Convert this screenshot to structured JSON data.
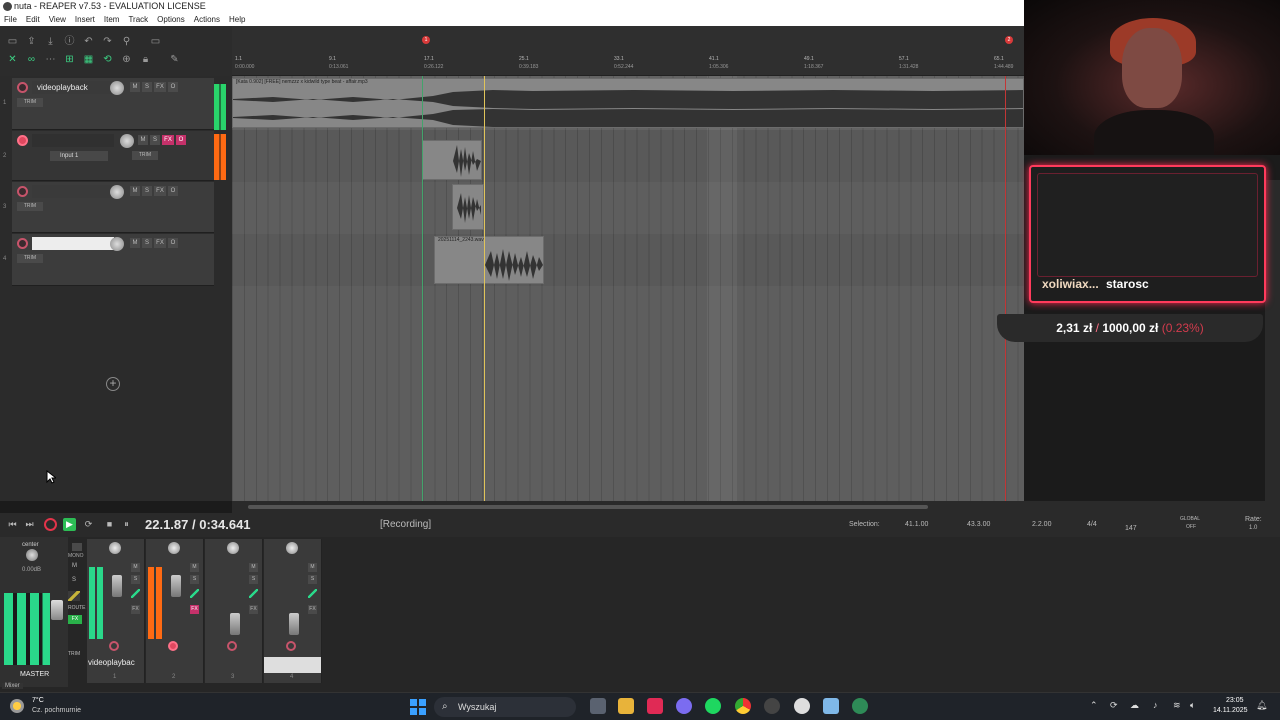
{
  "window": {
    "title": "nuta - REAPER v7.53 - EVALUATION LICENSE"
  },
  "menu": [
    "File",
    "Edit",
    "View",
    "Insert",
    "Item",
    "Track",
    "Options",
    "Actions",
    "Help"
  ],
  "tracks": [
    {
      "number": "1",
      "name": "videoplayback",
      "trim": "TRIM",
      "armed": false
    },
    {
      "number": "2",
      "name": "",
      "trim": "TRIM",
      "input": "Input 1",
      "armed": true
    },
    {
      "number": "3",
      "name": "",
      "trim": "TRIM",
      "armed": false
    },
    {
      "number": "4",
      "name": "",
      "trim": "TRIM",
      "armed": false
    }
  ],
  "track_buttons": {
    "mute": "M",
    "solo": "S",
    "fx": "FX",
    "route": "O"
  },
  "ruler": {
    "measures": [
      "1.1",
      "9.1",
      "17.1",
      "25.1",
      "33.1",
      "41.1",
      "49.1",
      "57.1",
      "65.1"
    ],
    "times": [
      "0:00.000",
      "0:13.061",
      "0:26.122",
      "0:39.183",
      "0:52.244",
      "1:05.306",
      "1:18.367",
      "1:31.428",
      "1:44.489"
    ],
    "markers": [
      "1",
      "2"
    ]
  },
  "items": {
    "track1": "[Kata 0.902] [FREE] nemzzz x kidwild type beat - affair.mp3",
    "track4": "20251114_2243.wav"
  },
  "transport": {
    "time": "22.1.87 / 0:34.641",
    "status": "[Recording]",
    "selection_label": "Selection:",
    "sel_start": "41.1.00",
    "sel_end": "43.3.00",
    "sel_len": "2.2.00",
    "time_sig": "4/4",
    "bpm": "147",
    "global": "GLOBAL",
    "global_off": "OFF",
    "rate_label": "Rate:",
    "rate": "1.0"
  },
  "mixer": {
    "master_label": "MASTER",
    "pan": "center",
    "master_vol": "0.00dB",
    "strip1_name": "videoplaybac",
    "strip_numbers": [
      "1",
      "2",
      "3",
      "4"
    ],
    "mixer_tab": "Mixer",
    "mute": "M",
    "solo": "S",
    "fx": "FX",
    "route": "ROUTE",
    "trim": "TRIM",
    "mono": "MONO"
  },
  "overlay": {
    "alert_user": "xoliwiax...",
    "alert_msg": "starosc",
    "goal_current": "2,31 zł",
    "goal_sep": "/",
    "goal_target": "1000,00 zł",
    "goal_percent": "(0.23%)"
  },
  "taskbar": {
    "temp": "7°C",
    "weather": "Cz. pochmurnie",
    "search": "Wyszukaj",
    "time": "23:05",
    "date": "14.11.2025"
  },
  "colors": {
    "accent_green": "#2dbd55",
    "record_red": "#e2344a",
    "overlay_red": "#ff3b5c"
  }
}
